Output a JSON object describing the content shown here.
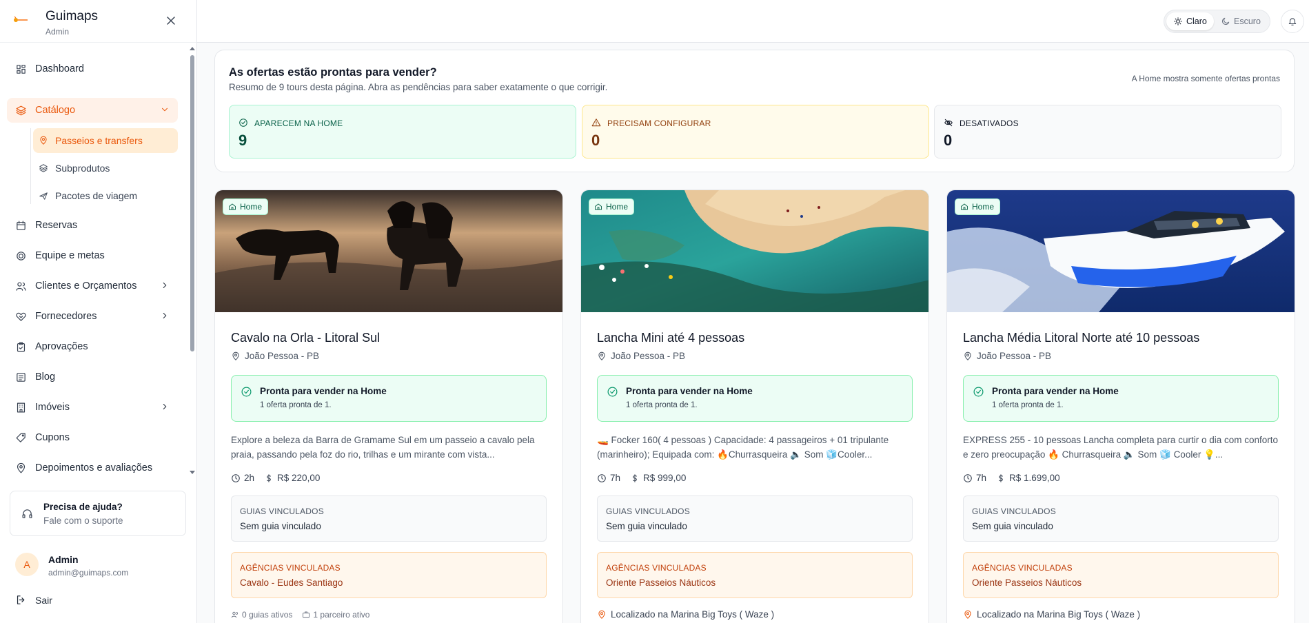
{
  "app": {
    "name": "Guimaps",
    "role": "Admin"
  },
  "sidebar": {
    "items": [
      {
        "label": "Dashboard"
      },
      {
        "label": "Catálogo"
      },
      {
        "label": "Reservas"
      },
      {
        "label": "Equipe e metas"
      },
      {
        "label": "Clientes e Orçamentos"
      },
      {
        "label": "Fornecedores"
      },
      {
        "label": "Aprovações"
      },
      {
        "label": "Blog"
      },
      {
        "label": "Imóveis"
      },
      {
        "label": "Cupons"
      },
      {
        "label": "Depoimentos e avaliações"
      }
    ],
    "catalog_sub": [
      {
        "label": "Passeios e transfers"
      },
      {
        "label": "Subprodutos"
      },
      {
        "label": "Pacotes de viagem"
      }
    ],
    "help": {
      "title": "Precisa de ajuda?",
      "subtitle": "Fale com o suporte"
    },
    "user": {
      "initial": "A",
      "name": "Admin",
      "email": "admin@guimaps.com"
    },
    "logout": "Sair"
  },
  "topbar": {
    "light": "Claro",
    "dark": "Escuro"
  },
  "summary": {
    "title": "As ofertas estão prontas para vender?",
    "description": "Resumo de 9 tours desta página. Abra as pendências para saber exatamente o que corrigir.",
    "note": "A Home mostra somente ofertas prontas",
    "stats": [
      {
        "label": "APARECEM NA HOME",
        "value": "9"
      },
      {
        "label": "PRECISAM CONFIGURAR",
        "value": "0"
      },
      {
        "label": "DESATIVADOS",
        "value": "0"
      }
    ]
  },
  "cards": [
    {
      "badge": "Home",
      "title": "Cavalo na Orla - Litoral Sul",
      "location": "João Pessoa - PB",
      "ready_title": "Pronta para vender na Home",
      "ready_sub": "1 oferta pronta de 1.",
      "description": "Explore a beleza da Barra de Gramame Sul em um passeio a cavalo pela praia, passando pela foz do rio, trilhas e um mirante com vista...",
      "duration": "2h",
      "price": "R$ 220,00",
      "guides_label": "GUIAS VINCULADOS",
      "guides_value": "Sem guia vinculado",
      "agencies_label": "AGÊNCIAS VINCULADAS",
      "agencies_value": "Cavalo - Eudes Santiago",
      "footer_guides": "0 guias ativos",
      "footer_partners": "1 parceiro ativo"
    },
    {
      "badge": "Home",
      "title": "Lancha Mini até 4 pessoas",
      "location": "João Pessoa - PB",
      "ready_title": "Pronta para vender na Home",
      "ready_sub": "1 oferta pronta de 1.",
      "description": "🚤 Focker 160( 4 pessoas ) Capacidade: 4 passageiros + 01 tripulante (marinheiro); Equipada com: 🔥Churrasqueira 🔈 Som 🧊Cooler...",
      "duration": "7h",
      "price": "R$ 999,00",
      "guides_label": "GUIAS VINCULADOS",
      "guides_value": "Sem guia vinculado",
      "agencies_label": "AGÊNCIAS VINCULADAS",
      "agencies_value": "Oriente Passeios Náuticos",
      "footer_location": "Localizado na Marina Big Toys ( Waze )"
    },
    {
      "badge": "Home",
      "title": "Lancha Média Litoral Norte até 10 pessoas",
      "location": "João Pessoa - PB",
      "ready_title": "Pronta para vender na Home",
      "ready_sub": "1 oferta pronta de 1.",
      "description": "EXPRESS 255 - 10 pessoas Lancha completa para curtir o dia com conforto e zero preocupação 🔥 Churrasqueira 🔈 Som 🧊 Cooler 💡...",
      "duration": "7h",
      "price": "R$ 1.699,00",
      "guides_label": "GUIAS VINCULADOS",
      "guides_value": "Sem guia vinculado",
      "agencies_label": "AGÊNCIAS VINCULADAS",
      "agencies_value": "Oriente Passeios Náuticos",
      "footer_location": "Localizado na Marina Big Toys ( Waze )"
    }
  ],
  "colors": {
    "accent": "#ea580c",
    "success": "#059669",
    "warning": "#d97706"
  }
}
